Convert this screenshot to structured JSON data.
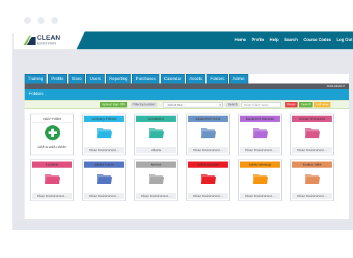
{
  "brand": {
    "title": "CLEAN",
    "subtitle": "Environment"
  },
  "topnav": [
    "Home",
    "Profile",
    "Help",
    "Search",
    "Course Codes",
    "Log Out"
  ],
  "tabs": [
    "Training",
    "Profile",
    "Store",
    "Users",
    "Reporting",
    "Purchases",
    "Calendar",
    "Assets",
    "Folders",
    "Admin"
  ],
  "instructions_label": "Instructions ▾",
  "section_title": "Folders",
  "filters": {
    "upload_signoffs": "Upload Sign Offs",
    "filter_by_location": "Filter by location",
    "location_value": "- Select One -",
    "search_label": "Search",
    "search_placeholder": "Enter folder name",
    "reset": "Reset",
    "search_button": "Search",
    "list_view": "List View"
  },
  "add_folder": {
    "title": "Add A Folder",
    "caption": "Click to add a folder"
  },
  "folders": [
    {
      "name": "Company Policies",
      "location": "Clean Environment ...",
      "color": "#29b7e6"
    },
    {
      "name": "Compliance",
      "location": "Alberta",
      "color": "#33b7a4"
    },
    {
      "name": "Equipment Forms",
      "location": "Clean Environment ...",
      "color": "#6b93c4"
    },
    {
      "name": "Equipment Manuals",
      "location": "Clean Environment ...",
      "color": "#b36ad9"
    },
    {
      "name": "Human Resources",
      "location": "Clean Environment ...",
      "color": "#d8578a"
    },
    {
      "name": "Incidents",
      "location": "Clean Environment ...",
      "color": "#e04f7e"
    },
    {
      "name": "Jobsite Forms",
      "location": "Clean Environment ...",
      "color": "#5575c2"
    },
    {
      "name": "Memos",
      "location": "Clean Environment ...",
      "color": "#a9a9a9"
    },
    {
      "name": "Safety Manuals",
      "location": "Clean Environment ...",
      "color": "#ea1c24"
    },
    {
      "name": "Safety Meetings",
      "location": "Clean Environment ...",
      "color": "#f7950e"
    },
    {
      "name": "Toolbox Talks",
      "location": "Clean Environment ...",
      "color": "#e48e5c"
    }
  ]
}
